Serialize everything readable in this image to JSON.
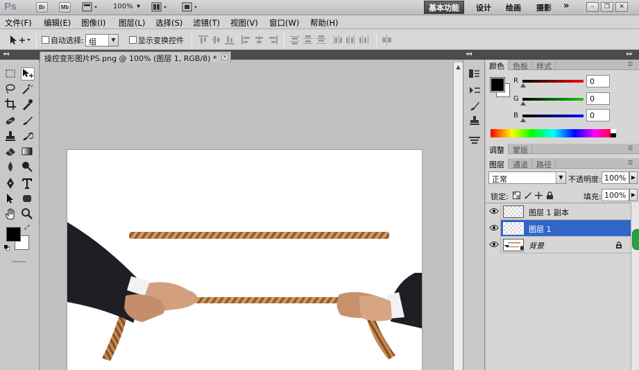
{
  "app": {
    "logo": "Ps",
    "bridge_button": "Br",
    "minibridge_button": "Mb",
    "zoom": "100%",
    "workspaces": [
      "基本功能",
      "设计",
      "绘画",
      "摄影"
    ],
    "more": "»"
  },
  "menu": [
    "文件(F)",
    "编辑(E)",
    "图像(I)",
    "图层(L)",
    "选择(S)",
    "滤镜(T)",
    "视图(V)",
    "窗口(W)",
    "帮助(H)"
  ],
  "options": {
    "auto_select_label": "自动选择:",
    "auto_select_value": "组",
    "show_transform_label": "显示变换控件"
  },
  "document": {
    "tab_title": "操控变形图片PS.png @ 100% (图层 1, RGB/8) *",
    "close": "×"
  },
  "color_panel": {
    "tabs": [
      "颜色",
      "色板",
      "样式"
    ],
    "channels": [
      {
        "label": "R",
        "value": "0"
      },
      {
        "label": "G",
        "value": "0"
      },
      {
        "label": "B",
        "value": "0"
      }
    ]
  },
  "adjust_panel": {
    "tabs": [
      "调整",
      "蒙版"
    ]
  },
  "layers_panel": {
    "tabs": [
      "图层",
      "通道",
      "路径"
    ],
    "blend_mode": "正常",
    "opacity_label": "不透明度:",
    "opacity_value": "100%",
    "lock_label": "锁定:",
    "fill_label": "填充:",
    "fill_value": "100%",
    "layers": [
      {
        "name": "图层 1 副本",
        "selected": false
      },
      {
        "name": "图层 1",
        "selected": true
      },
      {
        "name": "背景",
        "selected": false,
        "locked": true
      }
    ]
  }
}
